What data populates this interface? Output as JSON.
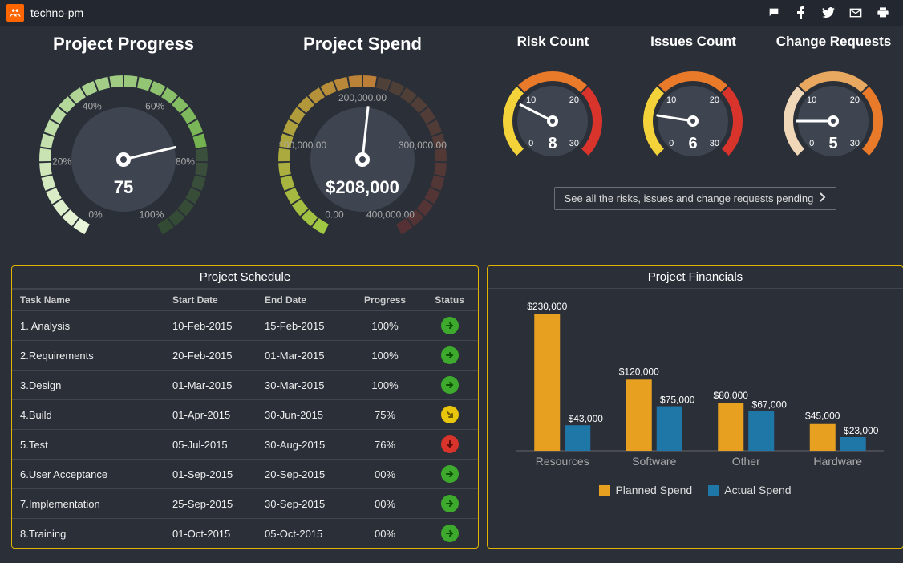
{
  "brand": "techno-pm",
  "gauges": {
    "progress": {
      "title": "Project Progress",
      "value": 75,
      "labels": [
        "0%",
        "20%",
        "40%",
        "60%",
        "80%",
        "100%"
      ]
    },
    "spend": {
      "title": "Project Spend",
      "value_display": "$208,000",
      "value": 208000,
      "labels": [
        "0.00",
        "100,000.00",
        "200,000.00",
        "300,000.00",
        "400,000.00"
      ]
    },
    "risk": {
      "title": "Risk Count",
      "value": 8,
      "ticks": [
        0,
        10,
        20,
        30
      ]
    },
    "issues": {
      "title": "Issues Count",
      "value": 6,
      "ticks": [
        0,
        10,
        20,
        30
      ]
    },
    "changes": {
      "title": "Change Requests",
      "value": 5,
      "ticks": [
        0,
        10,
        20,
        30
      ]
    }
  },
  "link_text": "See all the risks, issues and change requests pending",
  "schedule": {
    "title": "Project Schedule",
    "headers": [
      "Task Name",
      "Start Date",
      "End Date",
      "Progress",
      "Status"
    ],
    "rows": [
      {
        "task": "1. Analysis",
        "start": "10-Feb-2015",
        "end": "15-Feb-2015",
        "progress": "100%",
        "status": "green"
      },
      {
        "task": "2.Requirements",
        "start": "20-Feb-2015",
        "end": "01-Mar-2015",
        "progress": "100%",
        "status": "green"
      },
      {
        "task": "3.Design",
        "start": "01-Mar-2015",
        "end": "30-Mar-2015",
        "progress": "100%",
        "status": "green"
      },
      {
        "task": "4.Build",
        "start": "01-Apr-2015",
        "end": "30-Jun-2015",
        "progress": "75%",
        "status": "yellow"
      },
      {
        "task": "5.Test",
        "start": "05-Jul-2015",
        "end": "30-Aug-2015",
        "progress": "76%",
        "status": "red"
      },
      {
        "task": "6.User Acceptance",
        "start": "01-Sep-2015",
        "end": "20-Sep-2015",
        "progress": "00%",
        "status": "green"
      },
      {
        "task": "7.Implementation",
        "start": "25-Sep-2015",
        "end": "30-Sep-2015",
        "progress": "00%",
        "status": "green"
      },
      {
        "task": "8.Training",
        "start": "01-Oct-2015",
        "end": "05-Oct-2015",
        "progress": "00%",
        "status": "green"
      }
    ]
  },
  "financials": {
    "title": "Project Financials",
    "legend": {
      "planned": "Planned Spend",
      "actual": "Actual Spend"
    }
  },
  "chart_data": {
    "type": "bar",
    "title": "Project Financials",
    "categories": [
      "Resources",
      "Software",
      "Other",
      "Hardware"
    ],
    "series": [
      {
        "name": "Planned Spend",
        "values": [
          230000,
          120000,
          80000,
          45000
        ],
        "color": "#e8a020"
      },
      {
        "name": "Actual Spend",
        "values": [
          43000,
          75000,
          67000,
          23000
        ],
        "color": "#1f77a8"
      }
    ],
    "value_labels": [
      [
        "$230,000",
        "$120,000",
        "$80,000",
        "$45,000"
      ],
      [
        "$43,000",
        "$75,000",
        "$67,000",
        "$23,000"
      ]
    ],
    "ylim": [
      0,
      230000
    ]
  }
}
